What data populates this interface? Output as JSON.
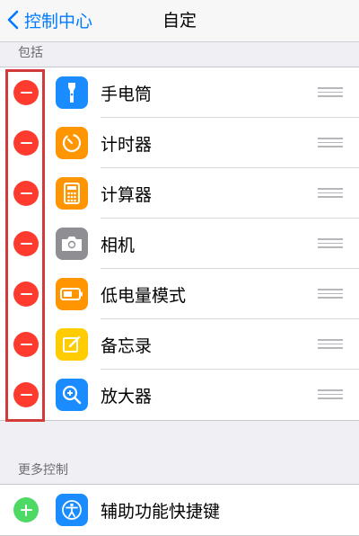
{
  "navbar": {
    "back_label": "控制中心",
    "title": "自定"
  },
  "included": {
    "header": "包括",
    "items": [
      {
        "label": "手电筒",
        "icon": "flashlight-icon",
        "color": "#1a8cff"
      },
      {
        "label": "计时器",
        "icon": "timer-icon",
        "color": "#ff9500"
      },
      {
        "label": "计算器",
        "icon": "calculator-icon",
        "color": "#ff9500"
      },
      {
        "label": "相机",
        "icon": "camera-icon",
        "color": "#8e8e93"
      },
      {
        "label": "低电量模式",
        "icon": "battery-icon",
        "color": "#ff9500"
      },
      {
        "label": "备忘录",
        "icon": "notes-icon",
        "color": "#ffcc00"
      },
      {
        "label": "放大器",
        "icon": "magnifier-icon",
        "color": "#1a8cff"
      }
    ]
  },
  "more": {
    "header": "更多控制",
    "items": [
      {
        "label": "辅助功能快捷键",
        "icon": "accessibility-icon",
        "color": "#1a8cff"
      }
    ]
  },
  "colors": {
    "accent": "#007aff",
    "remove": "#ff3b30",
    "add": "#4cd964",
    "highlight_border": "#d33a3a"
  }
}
